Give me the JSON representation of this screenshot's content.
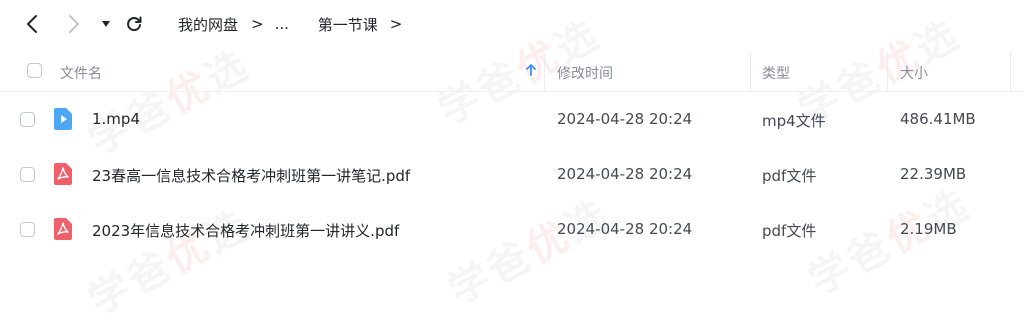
{
  "nav": {
    "breadcrumb": [
      "我的网盘",
      "...",
      "第一节课"
    ]
  },
  "table": {
    "headers": {
      "name": "文件名",
      "modified": "修改时间",
      "type": "类型",
      "size": "大小"
    },
    "rows": [
      {
        "name": "1.mp4",
        "modified": "2024-04-28 20:24",
        "type": "mp4文件",
        "size": "486.41MB",
        "icon": "video-file-icon"
      },
      {
        "name": "23春高一信息技术合格考冲刺班第一讲笔记.pdf",
        "modified": "2024-04-28 20:24",
        "type": "pdf文件",
        "size": "22.39MB",
        "icon": "pdf-file-icon"
      },
      {
        "name": "2023年信息技术合格考冲刺班第一讲讲义.pdf",
        "modified": "2024-04-28 20:24",
        "type": "pdf文件",
        "size": "2.19MB",
        "icon": "pdf-file-icon"
      }
    ]
  },
  "watermark": {
    "text_a": "学爸",
    "text_b": "优",
    "text_c": "选"
  },
  "colors": {
    "video_icon": "#4da7f5",
    "pdf_icon": "#f0606a",
    "sort_arrow": "#3e8ef7"
  }
}
